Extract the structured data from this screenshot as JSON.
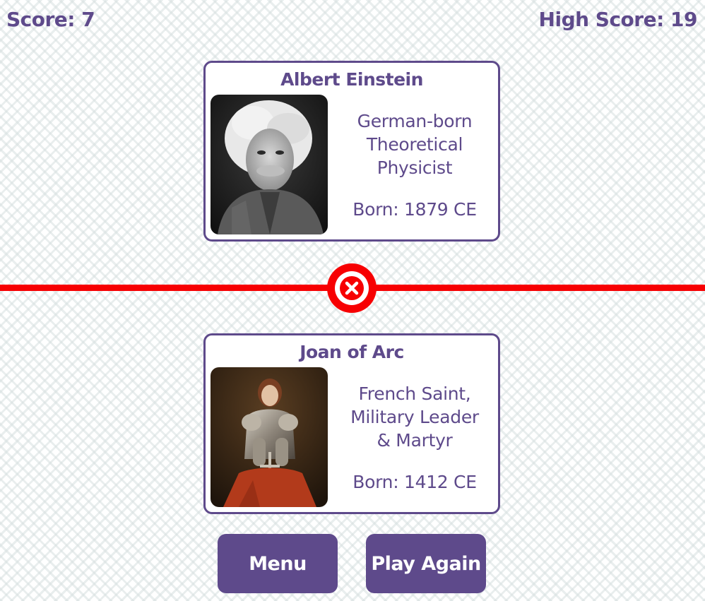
{
  "header": {
    "score": "Score: 7",
    "high_score": "High Score: 19"
  },
  "cards": {
    "top": {
      "name": "Albert Einstein",
      "description_lines": [
        "German-born",
        "Theoretical",
        "Physicist"
      ],
      "born": "Born: 1879 CE",
      "photo": "albert-einstein-portrait"
    },
    "bottom": {
      "name": "Joan of Arc",
      "description_lines": [
        "French Saint,",
        "Military Leader",
        "& Martyr"
      ],
      "born": "Born: 1412 CE",
      "photo": "joan-of-arc-painting"
    }
  },
  "result": {
    "icon": "x-circle-icon",
    "status": "incorrect",
    "color": "#f70002"
  },
  "buttons": {
    "menu": "Menu",
    "play_again": "Play Again"
  },
  "colors": {
    "accent": "#5e4a8b",
    "error": "#f70002",
    "card_bg": "#ffffff"
  }
}
